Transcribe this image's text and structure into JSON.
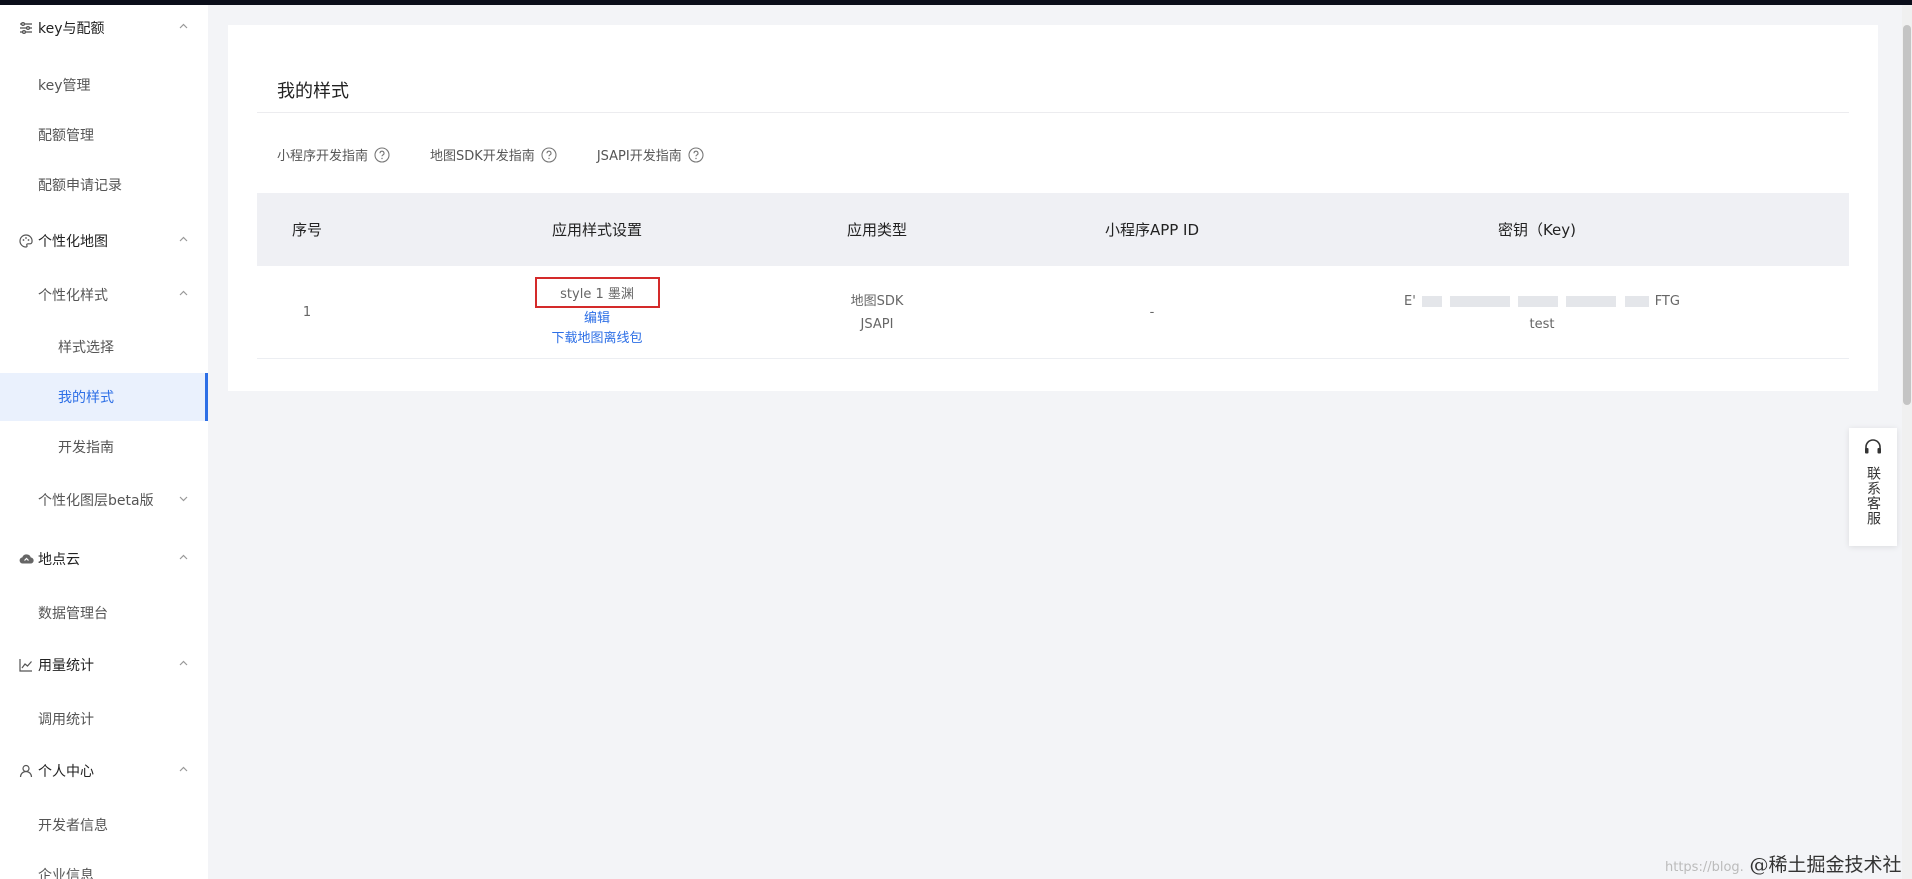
{
  "sidebar": {
    "groups": [
      {
        "label": "key与配额",
        "icon": "list-settings-icon"
      },
      {
        "label": "个性化地图",
        "icon": "palette-icon"
      },
      {
        "label": "地点云",
        "icon": "cloud-icon"
      },
      {
        "label": "用量统计",
        "icon": "line-chart-icon"
      },
      {
        "label": "个人中心",
        "icon": "user-icon"
      }
    ],
    "items": {
      "key_manage": "key管理",
      "quota_manage": "配额管理",
      "quota_records": "配额申请记录",
      "custom_style": "个性化样式",
      "style_select": "样式选择",
      "my_style": "我的样式",
      "dev_guide": "开发指南",
      "custom_layer": "个性化图层beta版",
      "data_console": "数据管理台",
      "call_stats": "调用统计",
      "developer_info": "开发者信息",
      "company_info": "企业信息"
    }
  },
  "main": {
    "title": "我的样式",
    "guides": [
      "小程序开发指南",
      "地图SDK开发指南",
      "JSAPI开发指南"
    ],
    "table": {
      "columns": [
        "序号",
        "应用样式设置",
        "应用类型",
        "小程序APP ID",
        "密钥（Key)"
      ],
      "rows": [
        {
          "index": "1",
          "style_name": "style 1 墨渊",
          "edit": "编辑",
          "download": "下载地图离线包",
          "type_1": "地图SDK",
          "type_2": "JSAPI",
          "app_id": "-",
          "key_prefix": "E'",
          "key_suffix": "FTG",
          "key_note": "test"
        }
      ]
    }
  },
  "service": {
    "label": "联系客服",
    "icon": "headset-icon"
  },
  "watermark": {
    "url": "https://blog.",
    "site": "@稀土掘金技术社区"
  },
  "colors": {
    "accent": "#2d6fe6",
    "highlight_border": "#d42a2a",
    "header_bg": "#eff0f4"
  }
}
